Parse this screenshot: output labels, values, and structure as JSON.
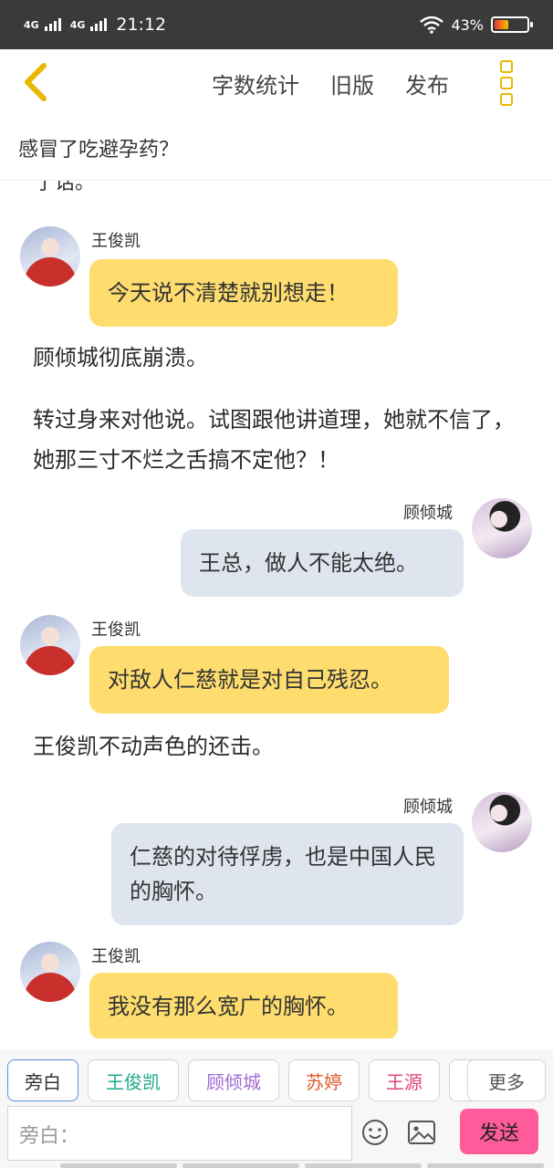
{
  "status": {
    "network1": "4G",
    "network2": "4G",
    "time": "21:12",
    "battery": "43%",
    "battery_level": 0.43
  },
  "topbar": {
    "word_count": "字数统计",
    "old_version": "旧版",
    "publish": "发布"
  },
  "title": "感冒了吃避孕药？",
  "cut_text": "了话。",
  "messages": [
    {
      "speaker": "王俊凯",
      "text": "今天说不清楚就别想走！"
    },
    {
      "narration": "顾倾城彻底崩溃。"
    },
    {
      "narration": "转过身来对他说。试图跟他讲道理，她就不信了，她那三寸不烂之舌搞不定他？！"
    },
    {
      "speaker": "顾倾城",
      "text": "王总，做人不能太绝。"
    },
    {
      "speaker": "王俊凯",
      "text": "对敌人仁慈就是对自己残忍。"
    },
    {
      "narration": "王俊凯不动声色的还击。"
    },
    {
      "speaker": "顾倾城",
      "text": "仁慈的对待俘虏，也是中国人民的胸怀。"
    },
    {
      "speaker": "王俊凯",
      "text": "我没有那么宽广的胸怀。"
    }
  ],
  "roles": [
    {
      "label": "旁白",
      "color": "#333333"
    },
    {
      "label": "王俊凯",
      "color": "#1ea98d"
    },
    {
      "label": "顾倾城",
      "color": "#a06cd5"
    },
    {
      "label": "苏婷",
      "color": "#e05a2e"
    },
    {
      "label": "王源",
      "color": "#e0467e"
    }
  ],
  "more_roles": "更多",
  "input": {
    "placeholder": "旁白："
  },
  "send_label": "发送"
}
